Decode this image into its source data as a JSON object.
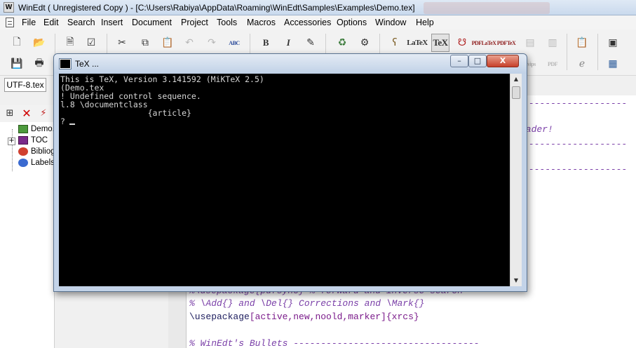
{
  "window": {
    "title": "WinEdt  ( Unregistered  Copy )  - [C:\\Users\\Rabiya\\AppData\\Roaming\\WinEdt\\Samples\\Examples\\Demo.tex]",
    "app_icon_label": "W"
  },
  "menu": [
    "File",
    "Edit",
    "Search",
    "Insert",
    "Document",
    "Project",
    "Tools",
    "Macros",
    "Accessories",
    "Options",
    "Window",
    "Help"
  ],
  "toolbar": {
    "icons": [
      "new-file-icon",
      "open-file-icon",
      "print-icon",
      "print-preview-icon",
      "cut-icon",
      "copy-icon",
      "paste-icon",
      "undo-icon",
      "redo-icon",
      "spellcheck-icon",
      "bold-icon",
      "italic-icon",
      "insert-icon",
      "gear-icon",
      "tree-icon",
      "latex-icon",
      "tex-icon",
      "pdflatex-icon",
      "pdftex-icon",
      "console-icon",
      "monitor-icon"
    ],
    "labels": {
      "bold": "B",
      "italic": "I",
      "latex": "LaTeX",
      "tex": "TeX",
      "pdflatex": "PDFLaTeX",
      "pdftex": "PDFTeX",
      "spell": "ABC",
      "pdf": "PDF",
      "dvips": "dvips"
    }
  },
  "encoding_tab": "UTF-8.tex",
  "tree": {
    "items": [
      {
        "label": "Demo.",
        "icon": "document-icon"
      },
      {
        "label": "TOC",
        "icon": "book-icon"
      },
      {
        "label": "Bibliog",
        "icon": "bibliography-icon"
      },
      {
        "label": "Labels",
        "icon": "labels-icon"
      }
    ],
    "expander": "+"
  },
  "editor": {
    "fragment_reader": "eader!",
    "dashes_1": "-------------------",
    "dashes_2": "-------------------",
    "dashes_3": "-------------------",
    "partial_line": "%\\usepackage{pdfsync} % forward and inverse search",
    "line_comment": "% \\Add{} and \\Del{} Corrections and \\Mark{}",
    "usepackage_cmd": "\\usepackage",
    "usepackage_opts": "[active,new,noold,marker]",
    "usepackage_arg": "{xrcs}",
    "bullets_line": "% WinEdt's Bullets ----------------------------------"
  },
  "console": {
    "title": "TeX ...",
    "lines": [
      "This is TeX, Version 3.141592 (MiKTeX 2.5)",
      "(Demo.tex",
      "! Undefined control sequence.",
      "l.8 \\documentclass",
      "                  {article}"
    ],
    "prompt": "?",
    "buttons": {
      "minimize": "–",
      "maximize": "□",
      "close": "X"
    }
  }
}
